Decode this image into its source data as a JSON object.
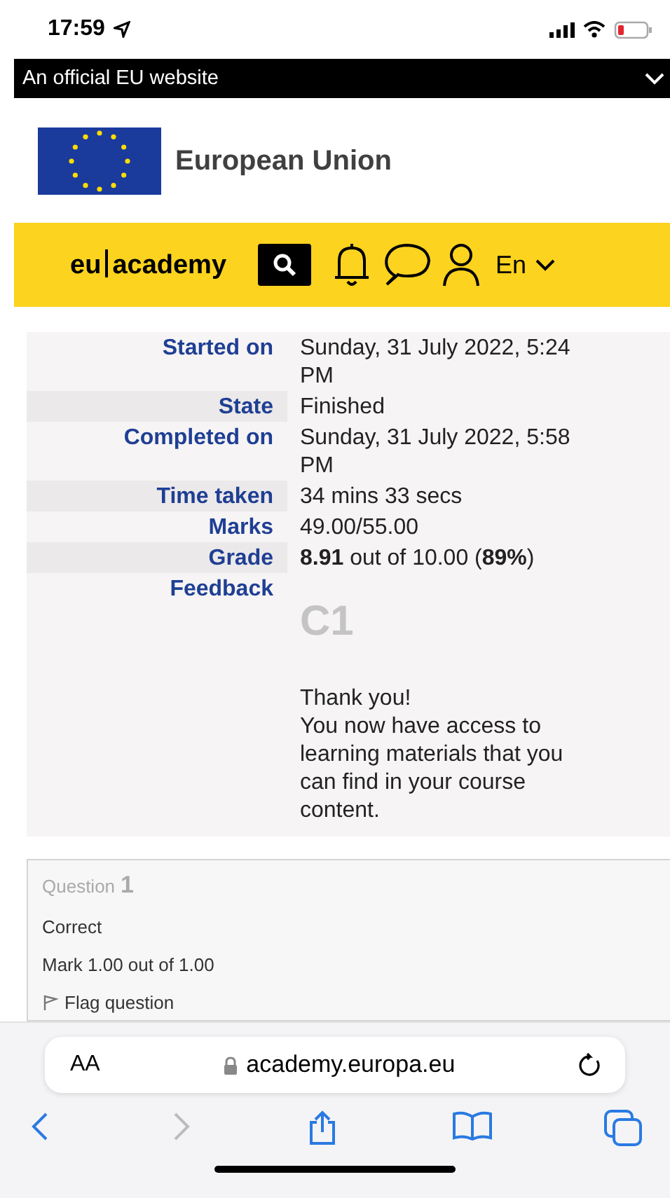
{
  "status_bar": {
    "time": "17:59"
  },
  "official_banner": {
    "text": "An official EU website",
    "expanded": false
  },
  "site_header": {
    "title": "European Union"
  },
  "nav_bar": {
    "brand_left": "eu",
    "brand_right": "academy",
    "language": "En"
  },
  "summary": [
    {
      "label": "Started on",
      "value": "Sunday, 31 July 2022, 5:24 PM"
    },
    {
      "label": "State",
      "value": "Finished"
    },
    {
      "label": "Completed on",
      "value": "Sunday, 31 July 2022, 5:58 PM"
    },
    {
      "label": "Time taken",
      "value": "34 mins 33 secs"
    },
    {
      "label": "Marks",
      "value": "49.00/55.00"
    },
    {
      "label": "Grade",
      "value": "**8.91** out of 10.00 (**89%**)"
    }
  ],
  "feedback": {
    "label": "Feedback",
    "heading": "C1",
    "lines": [
      "Thank you!",
      "You now have access to learning materials that you can find in your course content."
    ]
  },
  "question": {
    "prefix": "Question",
    "number": "1",
    "status": "Correct",
    "mark": "Mark 1.00 out of 1.00",
    "flag": "Flag question",
    "flagged": false
  },
  "browser": {
    "text_size": "AA",
    "url": "academy.europa.eu",
    "back_disabled": false,
    "forward_disabled": true
  }
}
